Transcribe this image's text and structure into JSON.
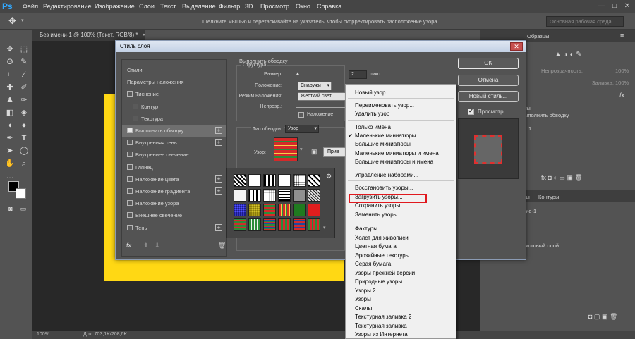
{
  "app": {
    "logo": "Ps"
  },
  "menubar": {
    "items": [
      "Файл",
      "Редактирование",
      "Изображение",
      "Слои",
      "Текст",
      "Выделение",
      "Фильтр",
      "3D",
      "Просмотр",
      "Окно",
      "Справка"
    ],
    "window_buttons": [
      "—",
      "□",
      "✕"
    ]
  },
  "optionsbar": {
    "hint": "Щелкните мышью и перетаскивайте на указатель, чтобы скорректировать расположение узора.",
    "workspace": "Основная рабочая среда"
  },
  "document": {
    "tab_title": "Без имени-1 @ 100% (Текст, RGB/8) *",
    "tab_close": "×"
  },
  "statusbar": {
    "zoom": "100%",
    "doc_info": "Док: 703,1K/208,6K"
  },
  "right_panel": {
    "tab_samples": "Образцы",
    "opacity_label": "Непрозрачность:",
    "opacity_value": "100%",
    "fill_label": "Заливка:",
    "fill_value": "100%",
    "effects_label": "ты",
    "stroke_effect": "ыполнить обводку",
    "layer_num": "1",
    "tab_layers": "лы",
    "tab_contours": "Контуры",
    "layer_name_1": "ние-1",
    "layer_name_2": "екстовый слой",
    "fx": "fx"
  },
  "dialog": {
    "title": "Стиль слоя",
    "close": "✕",
    "styles": [
      {
        "label": "Стили",
        "check": false,
        "plus": false,
        "selected": false,
        "indent": 0
      },
      {
        "label": "Параметры наложения",
        "check": false,
        "plus": false,
        "selected": false,
        "indent": 0
      },
      {
        "label": "Тиснение",
        "check": true,
        "checked": false,
        "plus": false,
        "selected": false,
        "indent": 0
      },
      {
        "label": "Контур",
        "check": true,
        "checked": false,
        "plus": false,
        "selected": false,
        "indent": 1
      },
      {
        "label": "Текстура",
        "check": true,
        "checked": false,
        "plus": false,
        "selected": false,
        "indent": 1
      },
      {
        "label": "Выполнить обводку",
        "check": true,
        "checked": true,
        "plus": true,
        "selected": true,
        "indent": 0
      },
      {
        "label": "Внутренняя тень",
        "check": true,
        "checked": false,
        "plus": true,
        "selected": false,
        "indent": 0
      },
      {
        "label": "Внутреннее свечение",
        "check": true,
        "checked": false,
        "plus": false,
        "selected": false,
        "indent": 0
      },
      {
        "label": "Глянец",
        "check": true,
        "checked": false,
        "plus": false,
        "selected": false,
        "indent": 0
      },
      {
        "label": "Наложение цвета",
        "check": true,
        "checked": false,
        "plus": true,
        "selected": false,
        "indent": 0
      },
      {
        "label": "Наложение градиента",
        "check": true,
        "checked": false,
        "plus": true,
        "selected": false,
        "indent": 0
      },
      {
        "label": "Наложение узора",
        "check": true,
        "checked": false,
        "plus": false,
        "selected": false,
        "indent": 0
      },
      {
        "label": "Внешнее свечение",
        "check": true,
        "checked": false,
        "plus": false,
        "selected": false,
        "indent": 0
      },
      {
        "label": "Тень",
        "check": true,
        "checked": false,
        "plus": true,
        "selected": false,
        "indent": 0
      }
    ],
    "fx_label": "fx",
    "stroke_group_title": "Выполнить обводку",
    "structure_title": "Структура",
    "size_label": "Размер:",
    "size_value": "2",
    "size_unit": "пикс.",
    "position_label": "Положение:",
    "position_value": "Снаружи",
    "blend_label": "Режим наложения:",
    "blend_value": "Жесткий свет",
    "opacity_label": "Непрозр.:",
    "overprint_label": "Наложение",
    "fill_type_label": "Тип обводки:",
    "fill_type_value": "Узор",
    "pattern_label": "Узор:",
    "snap_button": "Прив",
    "ok": "OK",
    "cancel": "Отмена",
    "new_style": "Новый стиль...",
    "preview_label": "Просмотр",
    "preview_checked": true
  },
  "context_menu": {
    "items": [
      "Новый узор...",
      "Переименовать узор...",
      "Удалить узор",
      "Только имена",
      "Маленькие миниатюры",
      "Большие миниатюры",
      "Маленькие миниатюры и имена",
      "Большие миниатюры и имена",
      "Управление наборами...",
      "Восстановить узоры...",
      "Загрузить узоры...",
      "Сохранить узоры...",
      "Заменить узоры...",
      "Фактуры",
      "Холст для живописи",
      "Цветная бумага",
      "Эрозийные текстуры",
      "Серая бумага",
      "Узоры прежней версии",
      "Природные узоры",
      "Узоры 2",
      "Узоры",
      "Скалы",
      "Текстурная заливка 2",
      "Текстурная заливка",
      "Узоры из Интернета"
    ],
    "checked_item": "Маленькие миниатюры",
    "highlighted_item": "Загрузить узоры..."
  },
  "colors": {
    "canvas_yellow": "#ffd814",
    "highlight_red": "#e0191e",
    "accent_blue": "#31a8ff"
  }
}
